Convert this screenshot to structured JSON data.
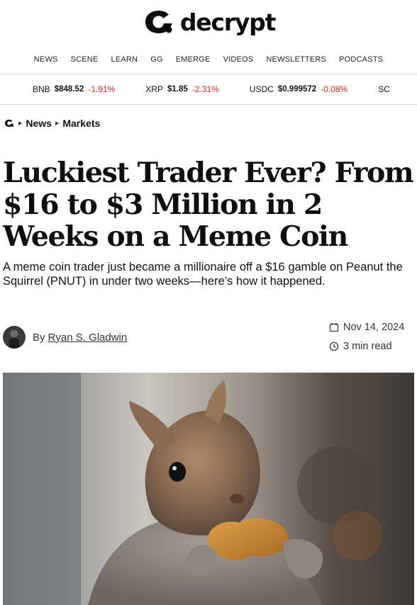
{
  "site": {
    "name": "decrypt",
    "logo_icon": "decrypt-logo-icon"
  },
  "nav": [
    "NEWS",
    "SCENE",
    "LEARN",
    "GG",
    "EMERGE",
    "VIDEOS",
    "NEWSLETTERS",
    "PODCASTS"
  ],
  "ticker": [
    {
      "symbol": "BNB",
      "price": "$848.52",
      "change": "-1.91%"
    },
    {
      "symbol": "XRP",
      "price": "$1.85",
      "change": "-2.31%"
    },
    {
      "symbol": "USDC",
      "price": "$0.999572",
      "change": "-0.08%"
    },
    {
      "symbol": "SC",
      "price": "",
      "change": ""
    }
  ],
  "breadcrumb": {
    "icon": "decrypt-logo-icon",
    "items": [
      "News",
      "Markets"
    ]
  },
  "article": {
    "headline": "Luckiest Trader Ever? From $16 to $3 Million in 2 Weeks on a Meme Coin",
    "dek": "A meme coin trader just became a millionaire off a $16 gamble on Peanut the Squirrel (PNUT) in under two weeks—here’s how it happened.",
    "by_label": "By",
    "author": "Ryan S. Gladwin",
    "date": "Nov 14, 2024",
    "read_time": "3 min read",
    "date_icon": "calendar-icon",
    "read_icon": "clock-icon",
    "hero_image": "squirrel eating a peanut"
  },
  "colors": {
    "negative": "#d4281d",
    "text": "#111111",
    "divider": "#dcdcdc"
  }
}
